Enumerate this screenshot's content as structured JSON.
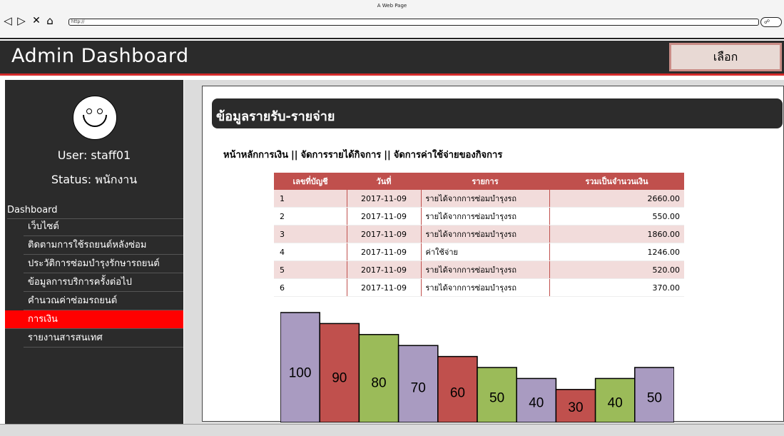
{
  "browser": {
    "window_title": "A Web Page",
    "url": "http://",
    "back_icon": "back-arrow-icon",
    "forward_icon": "forward-arrow-icon",
    "close_icon": "close-icon",
    "home_icon": "home-icon",
    "search_icon": "search-icon"
  },
  "header": {
    "title": "Admin Dashboard",
    "select_label": "เลือก"
  },
  "sidebar": {
    "avatar_icon": "smiley-face-icon",
    "user": "User: staff01",
    "status": "Status: พนักงาน",
    "dashboard_label": "Dashboard",
    "items": [
      {
        "label": "เว็บไซต์",
        "active": false
      },
      {
        "label": "ติดตามการใช้รถยนต์หลังซ่อม",
        "active": false
      },
      {
        "label": "ประวัติการซ่อมบำรุงรักษารถยนต์",
        "active": false
      },
      {
        "label": "ข้อมูลการบริการครั้งต่อไป",
        "active": false
      },
      {
        "label": "คำนวณค่าซ่อมรถยนต์",
        "active": false
      },
      {
        "label": "การเงิน",
        "active": true
      },
      {
        "label": "รายงานสารสนเทศ",
        "active": false
      }
    ]
  },
  "main": {
    "section_title": "ข้อมูลรายรับ-รายจ่าย",
    "breadcrumb": [
      "หน้าหลักการเงิน",
      "จัดการรายได้กิจการ",
      "จัดการค่าใช้จ่ายของกิจการ"
    ],
    "breadcrumb_sep": "||",
    "table": {
      "headers": [
        "เลขที่บัญชี",
        "วันที่",
        "รายการ",
        "รวมเป็นจำนวนเงิน"
      ],
      "rows": [
        [
          "1",
          "2017-11-09",
          "รายได้จากการซ่อมบำรุงรถ",
          "2660.00"
        ],
        [
          "2",
          "2017-11-09",
          "รายได้จากการซ่อมบำรุงรถ",
          "550.00"
        ],
        [
          "3",
          "2017-11-09",
          "รายได้จากการซ่อมบำรุงรถ",
          "1860.00"
        ],
        [
          "4",
          "2017-11-09",
          "ค่าใช้จ่าย",
          "1246.00"
        ],
        [
          "5",
          "2017-11-09",
          "รายได้จากการซ่อมบำรุงรถ",
          "520.00"
        ],
        [
          "6",
          "2017-11-09",
          "รายได้จากการซ่อมบำรุงรถ",
          "370.00"
        ]
      ]
    }
  },
  "chart_data": {
    "type": "bar",
    "categories": [
      "",
      "",
      "",
      "",
      "",
      "",
      "",
      "",
      "",
      ""
    ],
    "values": [
      100,
      90,
      80,
      70,
      60,
      50,
      40,
      30,
      40,
      50
    ],
    "colors": [
      "#a99bc1",
      "#c0504d",
      "#9bbb59",
      "#a99bc1",
      "#c0504d",
      "#9bbb59",
      "#a99bc1",
      "#c0504d",
      "#9bbb59",
      "#a99bc1"
    ],
    "ylim": [
      0,
      100
    ],
    "title": "",
    "xlabel": "",
    "ylabel": "",
    "grid": false
  },
  "colors": {
    "header_bg": "#2b2b2b",
    "accent_red": "#d42b2b",
    "active_item": "#ff0000",
    "table_header": "#c0504d",
    "table_stripe": "#f2dcdb",
    "select_button": "#e8d9d4"
  }
}
